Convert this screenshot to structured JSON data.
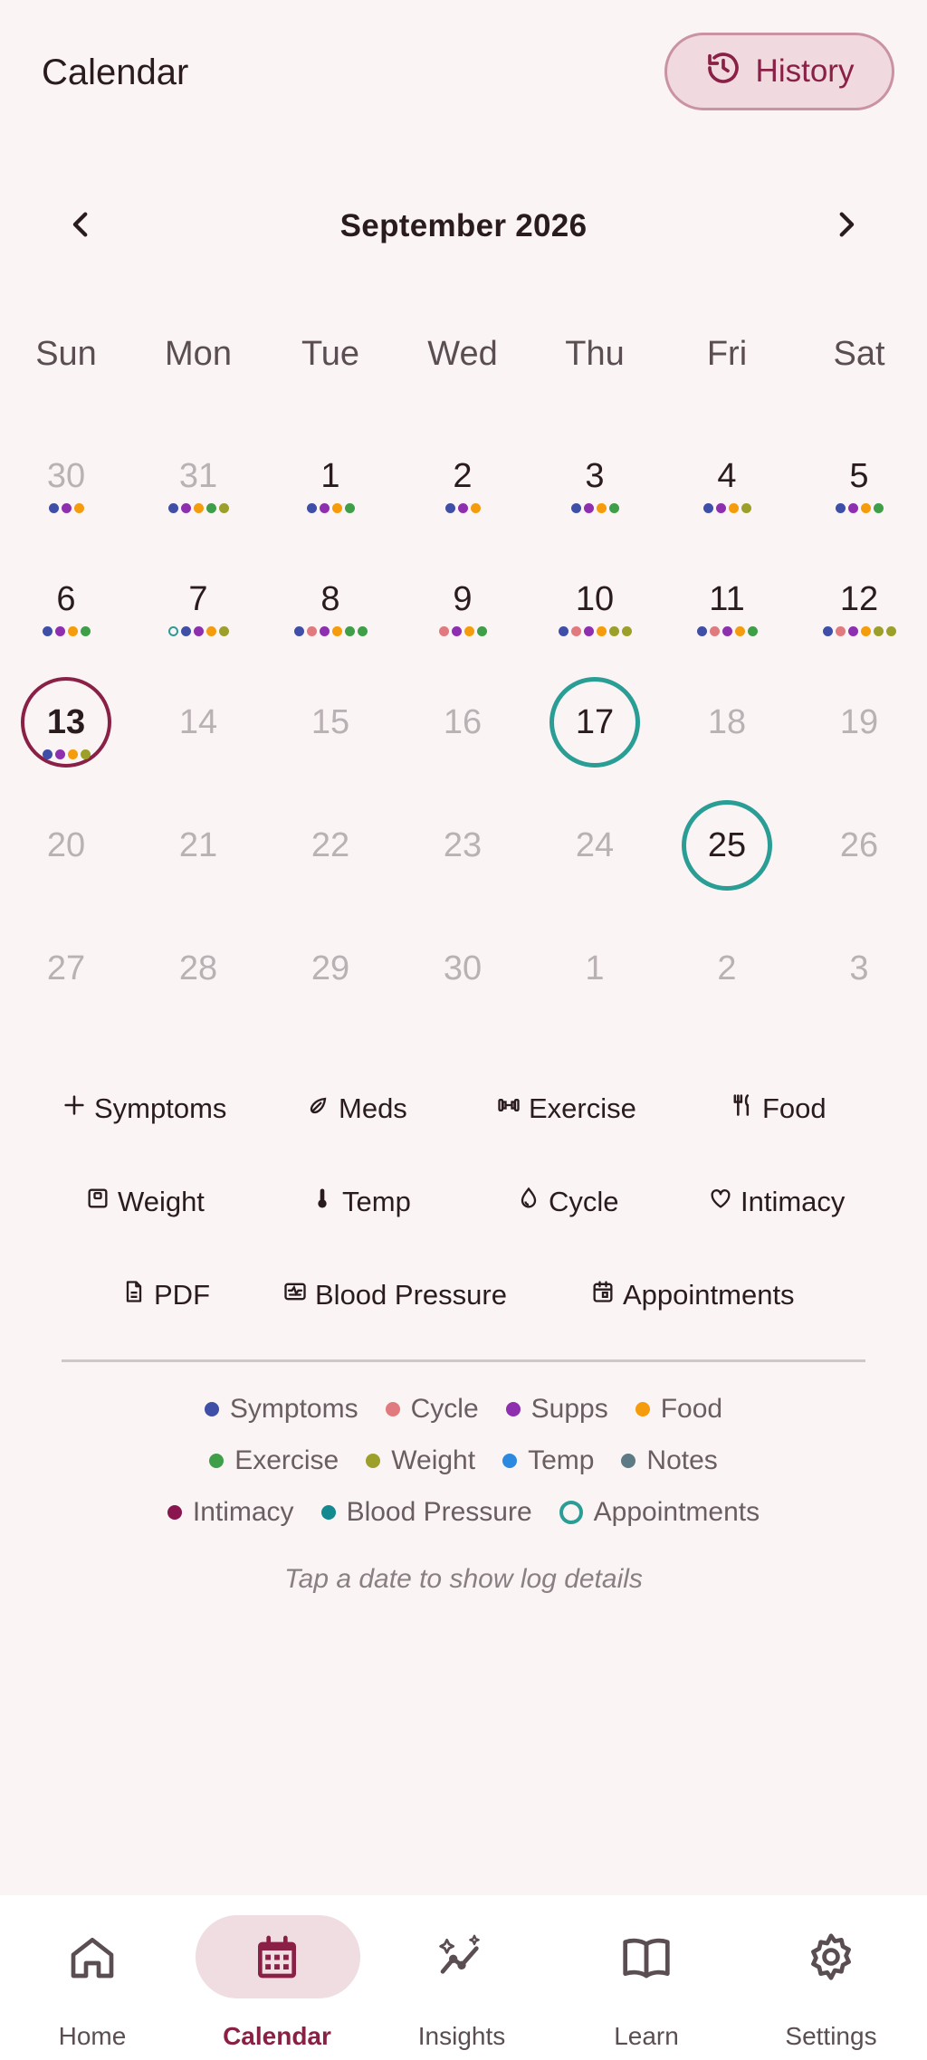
{
  "header": {
    "title": "Calendar",
    "history_label": "History"
  },
  "month": {
    "title": "September 2026"
  },
  "weekdays": [
    "Sun",
    "Mon",
    "Tue",
    "Wed",
    "Thu",
    "Fri",
    "Sat"
  ],
  "colors": {
    "symptoms": "#3f4fa8",
    "cycle": "#e07a7e",
    "supps": "#8e2fb0",
    "food": "#f59c0c",
    "exercise": "#3f9e48",
    "weight": "#9ca02a",
    "temp": "#2d88e0",
    "notes": "#5e7a84",
    "intimacy": "#8a1650",
    "blood_pressure": "#138a8f",
    "appointments": "#2a9d95"
  },
  "days": [
    {
      "label": "30",
      "muted": true,
      "dots": [
        "symptoms",
        "supps",
        "food"
      ]
    },
    {
      "label": "31",
      "muted": true,
      "dots": [
        "symptoms",
        "supps",
        "food",
        "exercise",
        "weight"
      ]
    },
    {
      "label": "1",
      "dots": [
        "symptoms",
        "supps",
        "food",
        "exercise"
      ]
    },
    {
      "label": "2",
      "dots": [
        "symptoms",
        "supps",
        "food"
      ]
    },
    {
      "label": "3",
      "dots": [
        "symptoms",
        "supps",
        "food",
        "exercise"
      ]
    },
    {
      "label": "4",
      "dots": [
        "symptoms",
        "supps",
        "food",
        "weight"
      ]
    },
    {
      "label": "5",
      "dots": [
        "symptoms",
        "supps",
        "food",
        "exercise"
      ]
    },
    {
      "label": "6",
      "dots": [
        "symptoms",
        "supps",
        "food",
        "exercise"
      ]
    },
    {
      "label": "7",
      "dots": [
        "appointments",
        "symptoms",
        "supps",
        "food",
        "weight"
      ]
    },
    {
      "label": "8",
      "dots": [
        "symptoms",
        "cycle",
        "supps",
        "food",
        "exercise",
        "exercise"
      ]
    },
    {
      "label": "9",
      "dots": [
        "cycle",
        "supps",
        "food",
        "exercise"
      ]
    },
    {
      "label": "10",
      "dots": [
        "symptoms",
        "cycle",
        "supps",
        "food",
        "weight",
        "weight"
      ]
    },
    {
      "label": "11",
      "dots": [
        "symptoms",
        "cycle",
        "supps",
        "food",
        "exercise"
      ]
    },
    {
      "label": "12",
      "dots": [
        "symptoms",
        "cycle",
        "supps",
        "food",
        "weight",
        "weight"
      ]
    },
    {
      "label": "13",
      "today": true,
      "dots": [
        "symptoms",
        "supps",
        "food",
        "weight"
      ]
    },
    {
      "label": "14",
      "muted": true,
      "dots": []
    },
    {
      "label": "15",
      "muted": true,
      "dots": []
    },
    {
      "label": "16",
      "muted": true,
      "dots": []
    },
    {
      "label": "17",
      "appointment": true,
      "dots": []
    },
    {
      "label": "18",
      "muted": true,
      "dots": []
    },
    {
      "label": "19",
      "muted": true,
      "dots": []
    },
    {
      "label": "20",
      "muted": true,
      "dots": []
    },
    {
      "label": "21",
      "muted": true,
      "dots": []
    },
    {
      "label": "22",
      "muted": true,
      "dots": []
    },
    {
      "label": "23",
      "muted": true,
      "dots": []
    },
    {
      "label": "24",
      "muted": true,
      "dots": []
    },
    {
      "label": "25",
      "appointment": true,
      "dots": []
    },
    {
      "label": "26",
      "muted": true,
      "dots": []
    },
    {
      "label": "27",
      "muted": true,
      "dots": []
    },
    {
      "label": "28",
      "muted": true,
      "dots": []
    },
    {
      "label": "29",
      "muted": true,
      "dots": []
    },
    {
      "label": "30",
      "muted": true,
      "dots": []
    },
    {
      "label": "1",
      "muted": true,
      "dots": []
    },
    {
      "label": "2",
      "muted": true,
      "dots": []
    },
    {
      "label": "3",
      "muted": true,
      "dots": []
    }
  ],
  "quick_actions": {
    "symptoms": "Symptoms",
    "meds": "Meds",
    "exercise": "Exercise",
    "food": "Food",
    "weight": "Weight",
    "temp": "Temp",
    "cycle": "Cycle",
    "intimacy": "Intimacy",
    "pdf": "PDF",
    "blood_pressure": "Blood Pressure",
    "appointments": "Appointments"
  },
  "legend": {
    "symptoms": "Symptoms",
    "cycle": "Cycle",
    "supps": "Supps",
    "food": "Food",
    "exercise": "Exercise",
    "weight": "Weight",
    "temp": "Temp",
    "notes": "Notes",
    "intimacy": "Intimacy",
    "blood_pressure": "Blood Pressure",
    "appointments": "Appointments"
  },
  "hint": "Tap a date to show log details",
  "nav": {
    "home": "Home",
    "calendar": "Calendar",
    "insights": "Insights",
    "learn": "Learn",
    "settings": "Settings"
  }
}
